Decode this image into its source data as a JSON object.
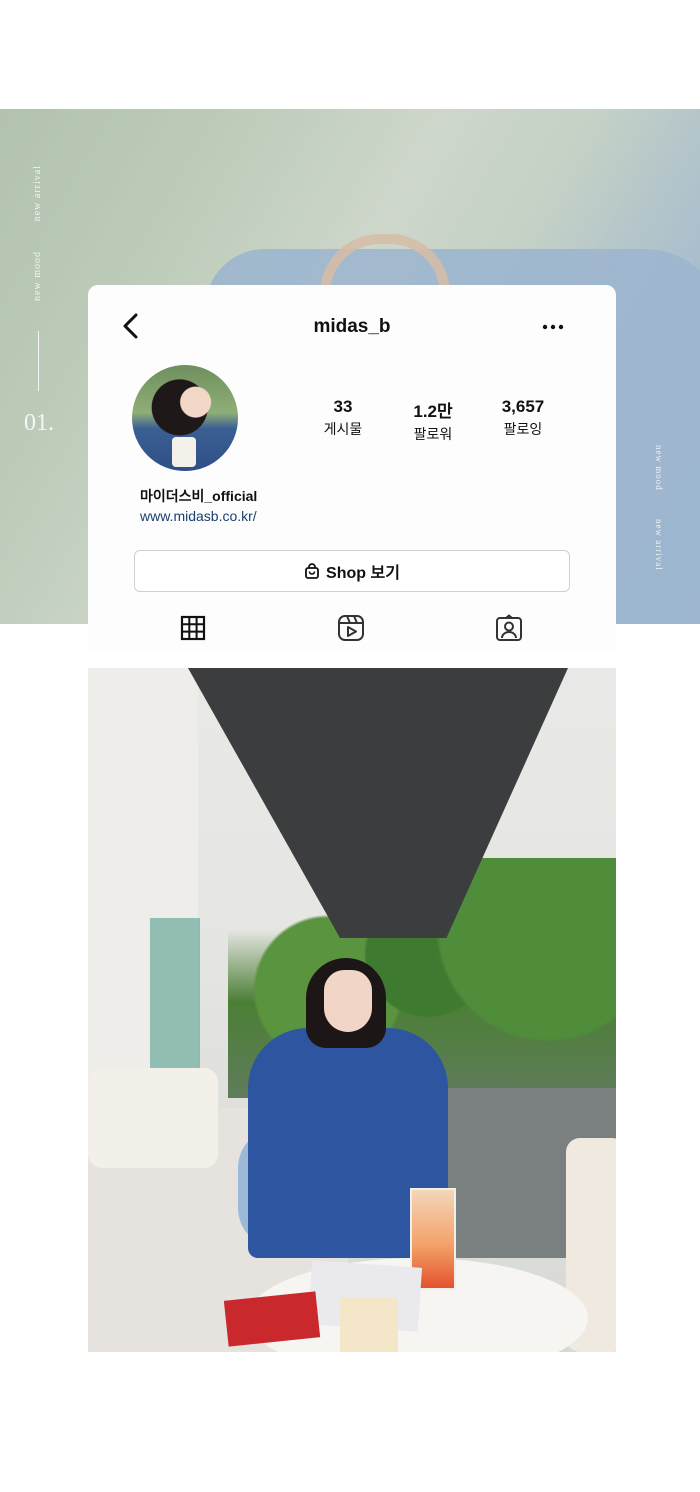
{
  "hero": {
    "side_text_1": "new arrival",
    "side_text_2": "new mood",
    "number": "01.",
    "right_text_1": "new mood",
    "right_text_2": "new arrival"
  },
  "profile": {
    "username": "midas_b",
    "stats": [
      {
        "value": "33",
        "label": "게시물"
      },
      {
        "value": "1.2만",
        "label": "팔로워"
      },
      {
        "value": "3,657",
        "label": "팔로잉"
      }
    ],
    "display_name": "마이더스비_official",
    "website": "www.midasb.co.kr/",
    "shop_button": "Shop 보기"
  },
  "icons": {
    "back": "chevron-left-icon",
    "more": "more-horizontal-icon",
    "shop": "shopping-bag-icon",
    "grid": "grid-icon",
    "reels": "reels-icon",
    "tagged": "tagged-person-icon"
  },
  "colors": {
    "link": "#1c3e6d",
    "accent_jacket": "#2e56a0"
  }
}
